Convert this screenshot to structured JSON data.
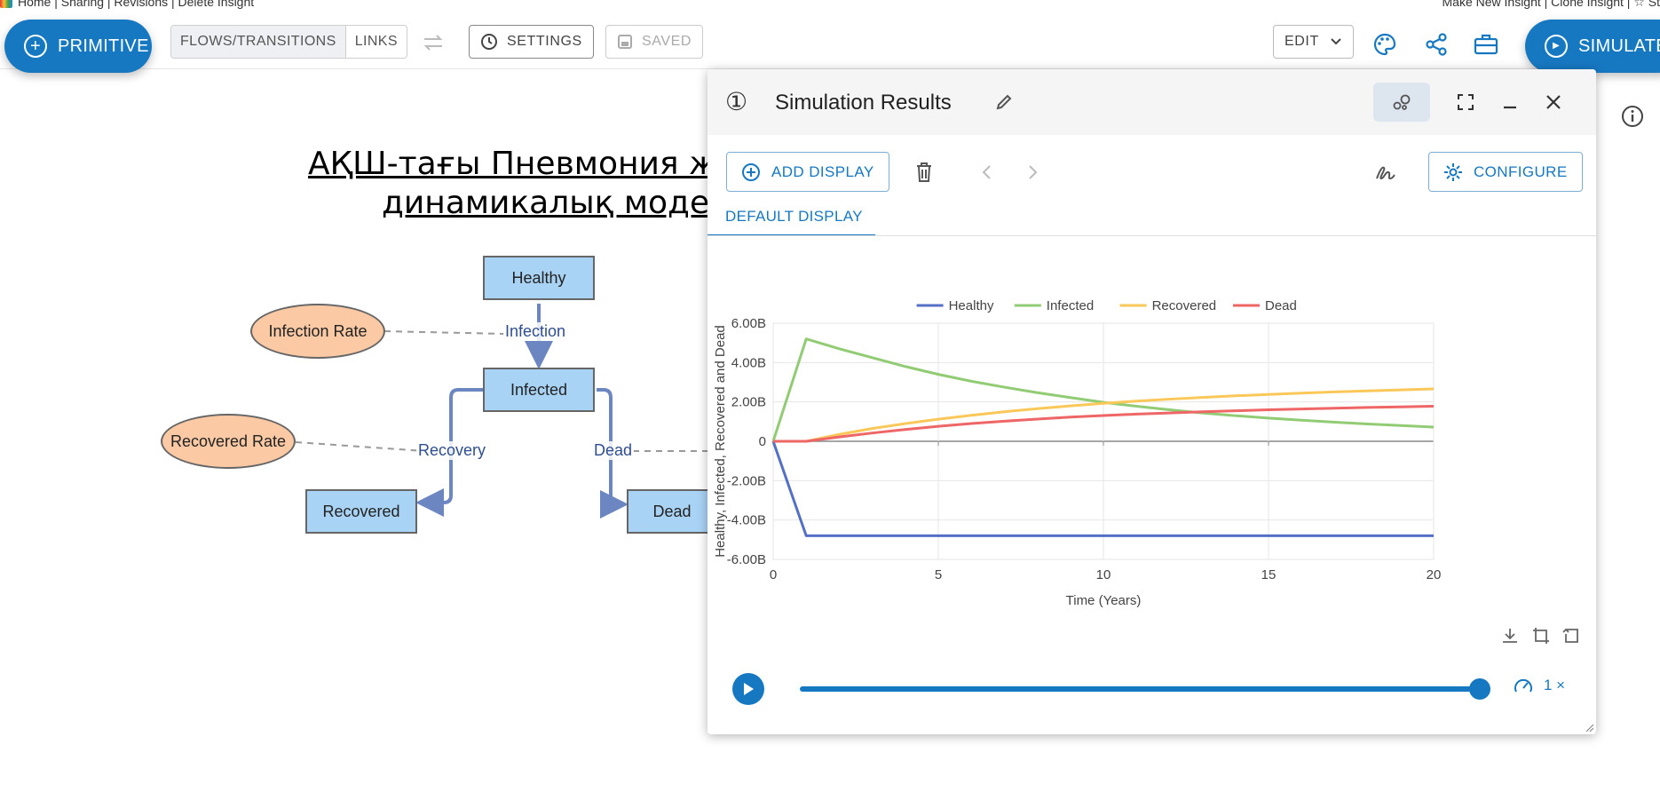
{
  "topbar": {
    "left_links": "Home | Sharing | Revisions | Delete Insight",
    "right_links": "Make New Insight | Clone Insight | ☆ St"
  },
  "toolbar": {
    "primitive_label": "PRIMITIVE",
    "flows_label": "FLOWS/TRANSITIONS",
    "links_label": "LINKS",
    "settings_label": "SETTINGS",
    "saved_label": "SAVED",
    "edit_label": "EDIT",
    "simulate_label": "SIMULATE"
  },
  "model": {
    "title_line1": "АҚШ-тағы Пневмония жұ",
    "title_line2": "динамикалық модел",
    "stocks": {
      "healthy": "Healthy",
      "infected": "Infected",
      "recovered": "Recovered",
      "dead": "Dead"
    },
    "variables": {
      "infection_rate": "Infection Rate",
      "recovered_rate": "Recovered Rate"
    },
    "flows": {
      "infection": "Infection",
      "recovery": "Recovery",
      "dead": "Dead"
    }
  },
  "panel": {
    "number": "①",
    "title": "Simulation Results",
    "add_display_label": "ADD DISPLAY",
    "configure_label": "CONFIGURE",
    "tab_label": "DEFAULT DISPLAY",
    "speed_label": "1 ×",
    "playback_progress": 1.0
  },
  "colors": {
    "accent": "#1778c2",
    "healthy": "#5470c6",
    "infected": "#91cc75",
    "recovered": "#fac858",
    "dead": "#ee6666",
    "stock_fill": "#a9d3f5",
    "variable_fill": "#fbc9a4"
  },
  "chart_data": {
    "type": "line",
    "title": "",
    "xlabel": "Time (Years)",
    "ylabel": "Healthy, Infected, Recovered and Dead",
    "x": [
      0,
      1,
      2,
      3,
      4,
      5,
      6,
      7,
      8,
      9,
      10,
      11,
      12,
      13,
      14,
      15,
      16,
      17,
      18,
      19,
      20
    ],
    "xlim": [
      0,
      20
    ],
    "ylim": [
      -6.0,
      6.0
    ],
    "y_unit": "B",
    "x_ticks": [
      "0",
      "5",
      "10",
      "15",
      "20"
    ],
    "y_ticks": [
      "6.00B",
      "4.00B",
      "2.00B",
      "0",
      "-2.00B",
      "-4.00B",
      "-6.00B"
    ],
    "legend_position": "top-center",
    "grid": true,
    "series": [
      {
        "name": "Healthy",
        "values": [
          0,
          -4.8,
          -4.8,
          -4.8,
          -4.8,
          -4.8,
          -4.8,
          -4.8,
          -4.8,
          -4.8,
          -4.8,
          -4.8,
          -4.8,
          -4.8,
          -4.8,
          -4.8,
          -4.8,
          -4.8,
          -4.8,
          -4.8,
          -4.8
        ]
      },
      {
        "name": "Infected",
        "values": [
          0,
          5.2,
          4.7,
          4.25,
          3.8,
          3.4,
          3.05,
          2.75,
          2.47,
          2.22,
          1.98,
          1.78,
          1.6,
          1.44,
          1.3,
          1.18,
          1.07,
          0.97,
          0.88,
          0.8,
          0.72
        ]
      },
      {
        "name": "Recovered",
        "values": [
          0,
          0.0,
          0.35,
          0.65,
          0.9,
          1.12,
          1.32,
          1.5,
          1.66,
          1.8,
          1.93,
          2.04,
          2.14,
          2.23,
          2.31,
          2.38,
          2.45,
          2.51,
          2.56,
          2.61,
          2.66
        ]
      },
      {
        "name": "Dead",
        "values": [
          0,
          0.0,
          0.22,
          0.42,
          0.6,
          0.76,
          0.9,
          1.02,
          1.13,
          1.23,
          1.31,
          1.38,
          1.44,
          1.5,
          1.55,
          1.6,
          1.64,
          1.68,
          1.72,
          1.75,
          1.78
        ]
      }
    ]
  }
}
